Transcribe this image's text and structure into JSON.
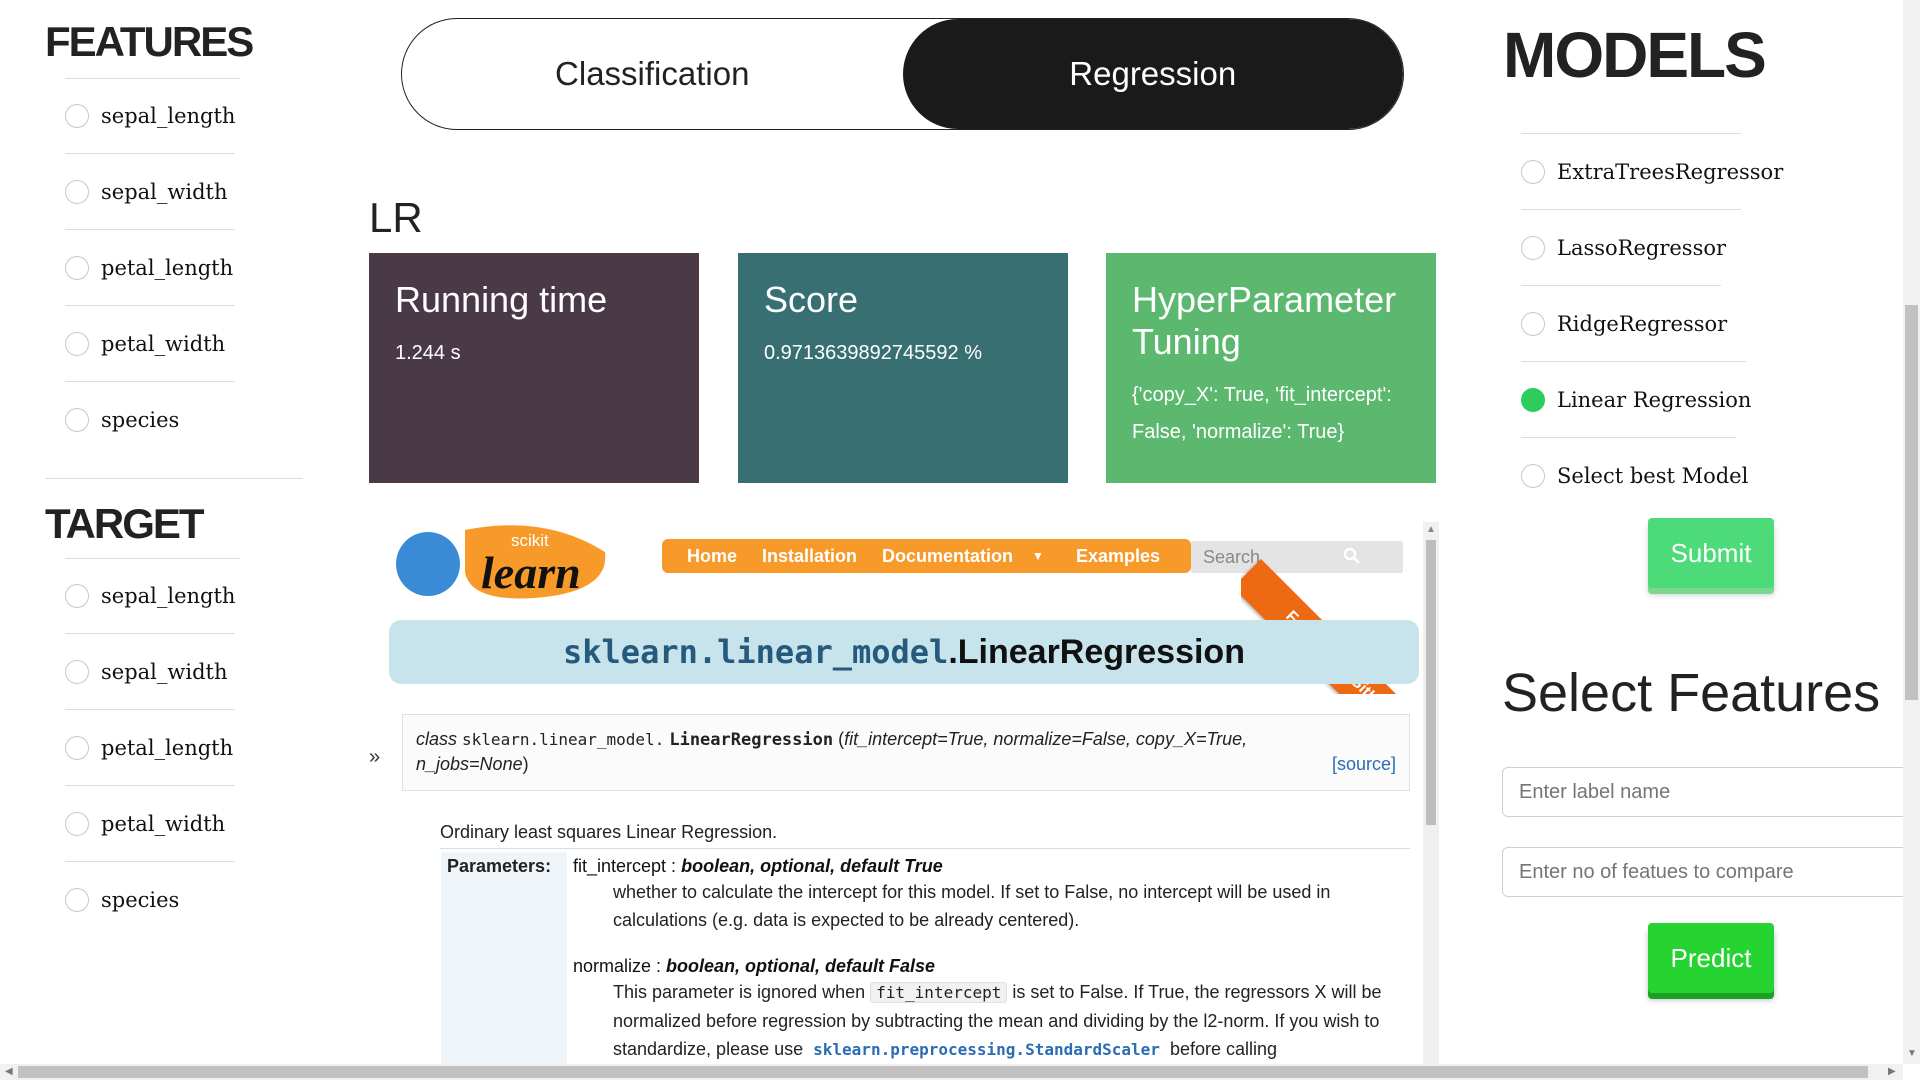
{
  "features": {
    "heading": "FEATURES",
    "items": [
      "sepal_length",
      "sepal_width",
      "petal_length",
      "petal_width",
      "species"
    ]
  },
  "target": {
    "heading": "TARGET",
    "items": [
      "sepal_length",
      "sepal_width",
      "petal_length",
      "petal_width",
      "species"
    ]
  },
  "toggle": {
    "options": [
      "Classification",
      "Regression"
    ],
    "active": "Regression"
  },
  "model_title": "LR",
  "cards": [
    {
      "title": "Running time",
      "value": "1.244 s",
      "color": "#4a3a48"
    },
    {
      "title": "Score",
      "value": "0.9713639892745592 %",
      "color": "#376f72"
    },
    {
      "title": "HyperParameter Tuning",
      "value": "{'copy_X': True, 'fit_intercept': False, 'normalize': True}",
      "color": "#5cb86e"
    }
  ],
  "docs": {
    "logo_small": "scikit",
    "logo_large": "learn",
    "nav": [
      "Home",
      "Installation",
      "Documentation",
      "Examples"
    ],
    "search_placeholder": "Search",
    "fork_ribbon": "Fork me on GitHub",
    "title_module": "sklearn.linear_model",
    "title_dot": ".",
    "title_class": "LinearRegression",
    "sig_class_kw": "class",
    "sig_module": "sklearn.linear_model.",
    "sig_name": "LinearRegression",
    "sig_args_line1": "fit_intercept=True, normalize=False, copy_X=True,",
    "sig_args_line2": "n_jobs=None",
    "source_link": "[source]",
    "gutter": "»",
    "description": "Ordinary least squares Linear Regression.",
    "params_heading": "Parameters:",
    "param1_name": "fit_intercept :",
    "param1_type": "boolean, optional, default True",
    "param1_text": "whether to calculate the intercept for this model. If set to False, no intercept will be used in calculations (e.g. data is expected to be already centered).",
    "param2_name": "normalize :",
    "param2_type": "boolean, optional, default False",
    "param2_text_a": "This parameter is ignored when",
    "param2_code": "fit_intercept",
    "param2_text_b": "is set to False. If True, the regressors X will be normalized before regression by subtracting the mean and dividing by the l2-norm. If you wish to standardize, please use",
    "param2_link": "sklearn.preprocessing.StandardScaler",
    "param2_text_c": "before calling"
  },
  "models": {
    "heading": "MODELS",
    "items": [
      "ExtraTreesRegressor",
      "LassoRegressor",
      "RidgeRegressor",
      "Linear Regression",
      "Select best Model"
    ],
    "selected": "Linear Regression",
    "submit_label": "Submit"
  },
  "select_features": {
    "heading": "Select Features",
    "label_placeholder": "Enter label name",
    "count_placeholder": "Enter no of featues to compare",
    "predict_label": "Predict"
  },
  "colors": {
    "accent_green": "#2ecc5c",
    "toggle_active": "#1a1a1a",
    "sklearn_orange": "#f89a2a"
  }
}
